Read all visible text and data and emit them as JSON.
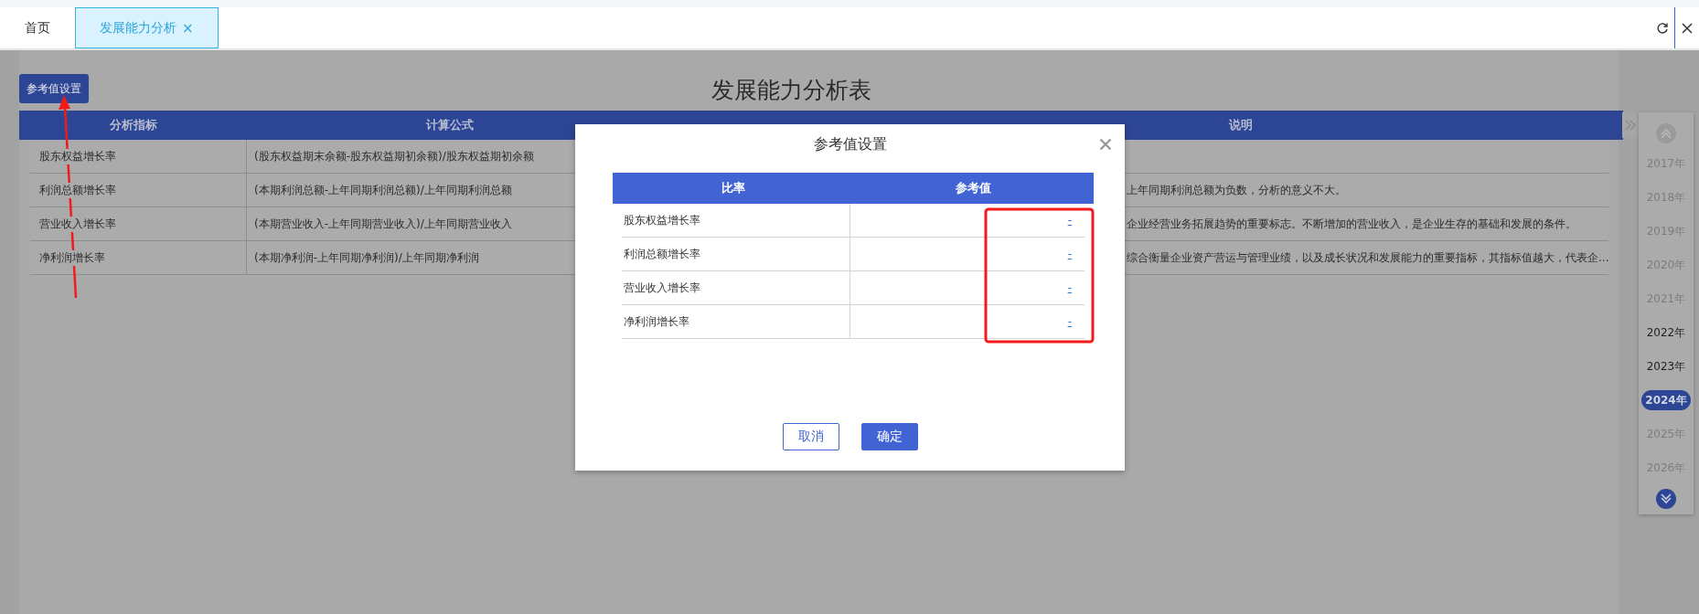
{
  "tabs": [
    {
      "label": "首页",
      "selected": false
    },
    {
      "label": "发展能力分析",
      "selected": true,
      "close_glyph": "×"
    }
  ],
  "page": {
    "title": "发展能力分析表",
    "settings_button": "参考值设置"
  },
  "table": {
    "columns": [
      "分析指标",
      "计算公式",
      "说明"
    ],
    "rows": [
      {
        "indicator": "股东权益增长率",
        "formula": "(股东权益期末余额-股东权益期初余额)/股东权益期初余额"
      },
      {
        "indicator": "利润总额增长率",
        "formula": "(本期利润总额-上年同期利润总额)/上年同期利润总额",
        "note": "上年同期利润总额为负数，分析的意义不大。"
      },
      {
        "indicator": "营业收入增长率",
        "formula": "(本期营业收入-上年同期营业收入)/上年同期营业收入",
        "note": "企业经营业务拓展趋势的重要标志。不断增加的营业收入，是企业生存的基础和发展的条件。"
      },
      {
        "indicator": "净利润增长率",
        "formula": "(本期净利润-上年同期净利润)/上年同期净利润",
        "note": "综合衡量企业资产营运与管理业绩，以及成长状况和发展能力的重要指标，其指标值越大，代表企..."
      }
    ]
  },
  "year_picker": {
    "years": [
      {
        "label": "2017年",
        "disabled": true,
        "selected": false
      },
      {
        "label": "2018年",
        "disabled": true,
        "selected": false
      },
      {
        "label": "2019年",
        "disabled": true,
        "selected": false
      },
      {
        "label": "2020年",
        "disabled": true,
        "selected": false
      },
      {
        "label": "2021年",
        "disabled": true,
        "selected": false
      },
      {
        "label": "2022年",
        "disabled": false,
        "selected": false
      },
      {
        "label": "2023年",
        "disabled": false,
        "selected": false
      },
      {
        "label": "2024年",
        "disabled": false,
        "selected": true
      },
      {
        "label": "2025年",
        "disabled": true,
        "selected": false
      },
      {
        "label": "2026年",
        "disabled": true,
        "selected": false
      }
    ]
  },
  "dialog": {
    "title": "参考值设置",
    "columns": [
      "比率",
      "参考值"
    ],
    "rows": [
      {
        "ratio": "股东权益增长率",
        "value": "-"
      },
      {
        "ratio": "利润总额增长率",
        "value": "-"
      },
      {
        "ratio": "营业收入增长率",
        "value": "-"
      },
      {
        "ratio": "净利润增长率",
        "value": "-"
      }
    ],
    "buttons": [
      {
        "label": "取消",
        "kind": "secondary"
      },
      {
        "label": "确定",
        "kind": "primary"
      }
    ]
  }
}
